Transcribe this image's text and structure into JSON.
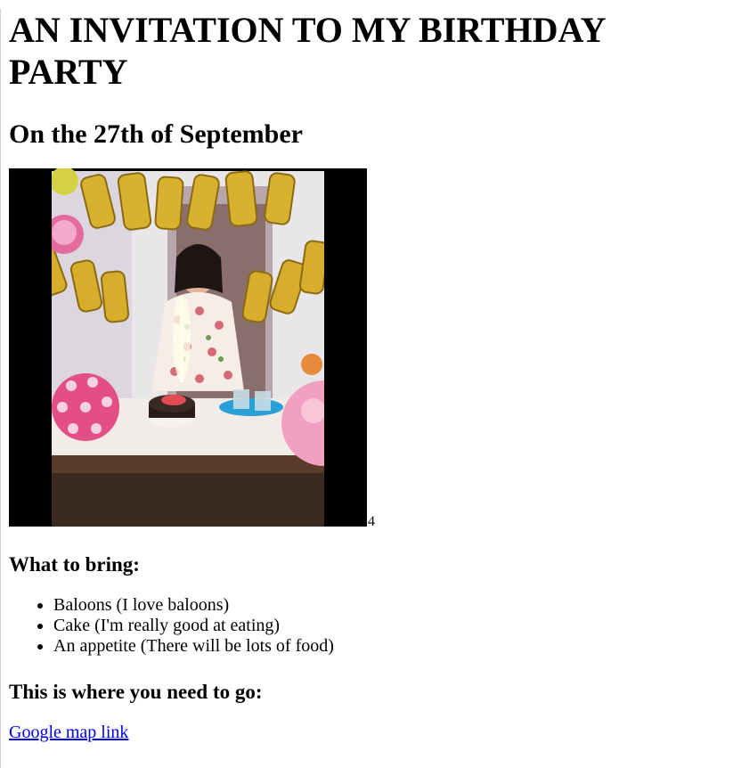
{
  "page": {
    "title": "AN INVITATION TO MY BIRTHDAY PARTY",
    "subtitle": "On the 27th of September"
  },
  "photo": {
    "caption": "4",
    "alt_description": "Birthday girl cutting cake under Happy Birthday balloons"
  },
  "bring": {
    "heading": "What to bring:",
    "items": [
      "Baloons (I love baloons)",
      "Cake (I'm really good at eating)",
      "An appetite (There will be lots of food)"
    ]
  },
  "directions": {
    "heading": "This is where you need to go:",
    "link_label": "Google map link"
  },
  "colors": {
    "link": "#0000ee",
    "text": "#000000",
    "background": "#ffffff"
  }
}
